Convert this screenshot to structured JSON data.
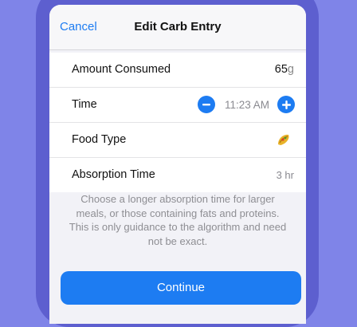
{
  "nav": {
    "cancel_label": "Cancel",
    "title": "Edit Carb Entry"
  },
  "rows": {
    "amount": {
      "label": "Amount Consumed",
      "value": "65",
      "unit": "g"
    },
    "time": {
      "label": "Time",
      "value": "11:23 AM",
      "decrement_icon": "minus-icon",
      "increment_icon": "plus-icon"
    },
    "food_type": {
      "label": "Food Type",
      "icon": "taco-icon"
    },
    "absorption": {
      "label": "Absorption Time",
      "value": "3 hr"
    }
  },
  "footnote": "Choose a longer absorption time for larger meals, or those containing fats and proteins. This is only guidance to the algorithm and need not be exact.",
  "continue_label": "Continue",
  "colors": {
    "accent": "#1d7cf2",
    "background": "#7f84e8",
    "frame": "#5d5fcf"
  }
}
